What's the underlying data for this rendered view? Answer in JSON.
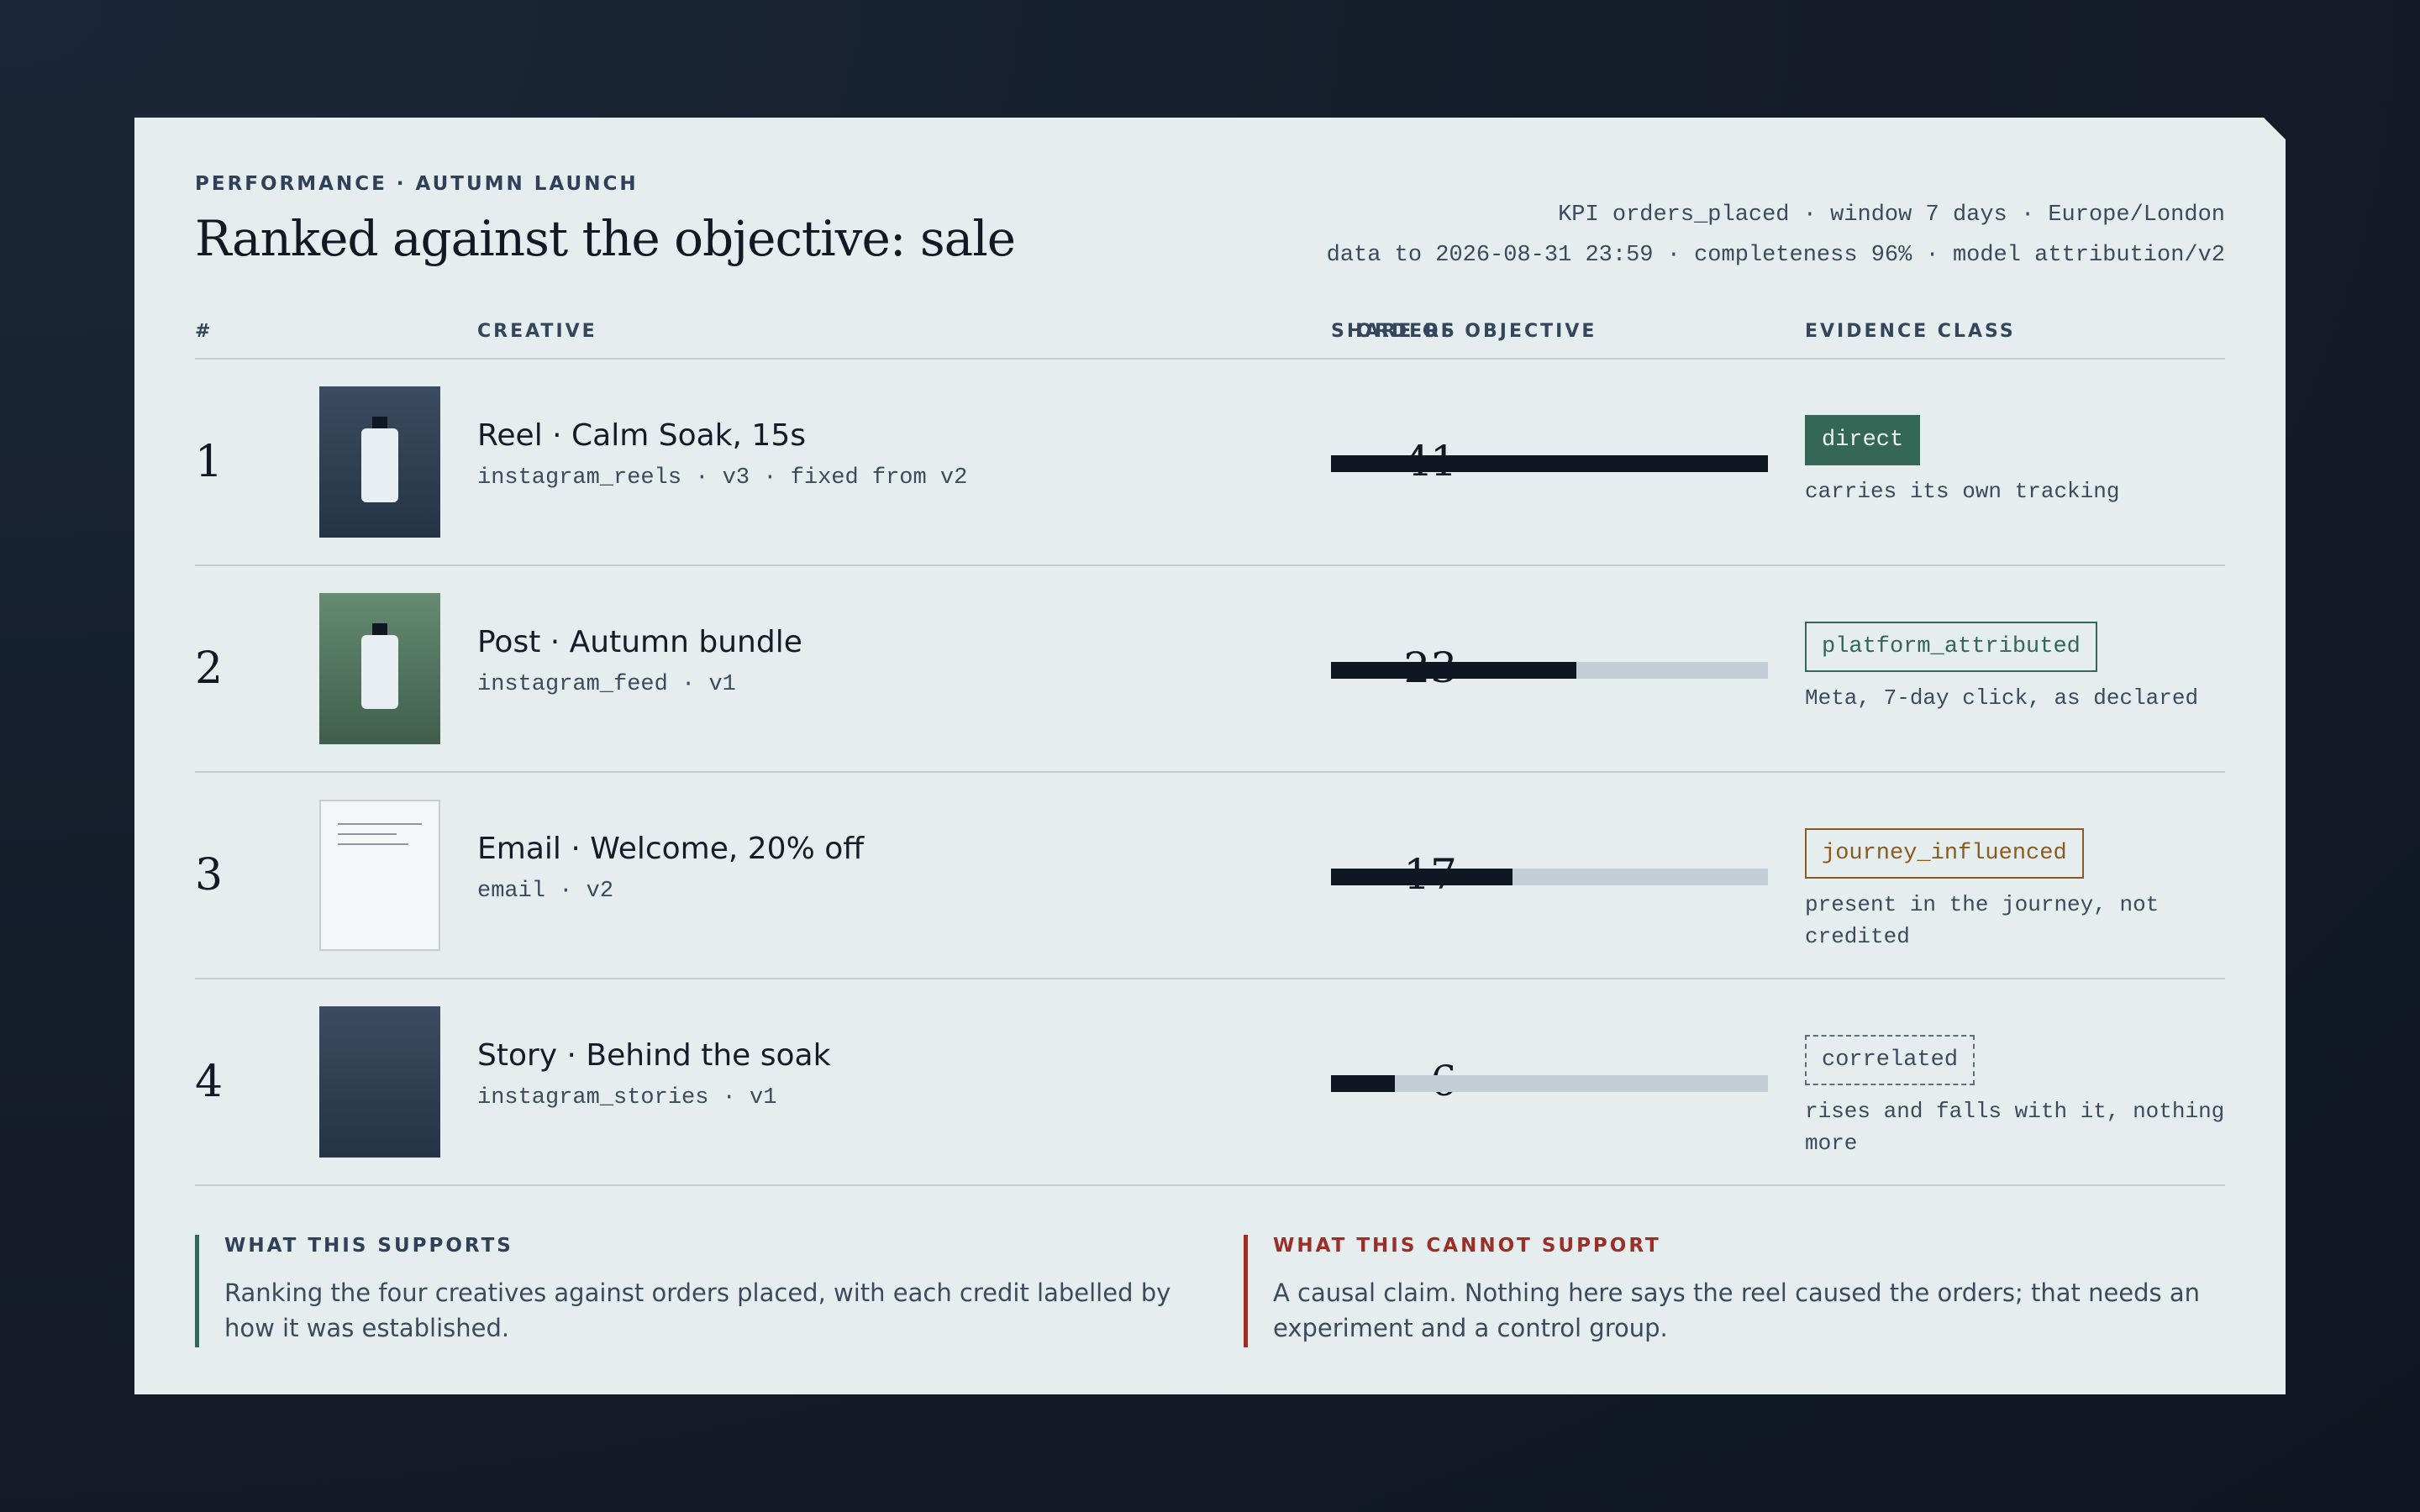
{
  "header": {
    "eyebrow": "PERFORMANCE · AUTUMN LAUNCH",
    "title": "Ranked against the objective: sale",
    "meta_line1": "KPI orders_placed · window 7 days · Europe/London",
    "meta_line2": "data to 2026-08-31 23:59 · completeness 96% · model attribution/v2"
  },
  "columns": {
    "rank": "#",
    "creative": "CREATIVE",
    "orders": "ORDERS",
    "share": "SHARE OF OBJECTIVE",
    "evidence": "EVIDENCE CLASS"
  },
  "rows": [
    {
      "rank": "1",
      "name": "Reel · Calm Soak, 15s",
      "sub": "instagram_reels · v3 · fixed from v2",
      "orders": "41",
      "share_fraction": 1.0,
      "thumb": "bottle-dark",
      "badge": "direct",
      "badge_style": "direct",
      "desc": "carries its own tracking"
    },
    {
      "rank": "2",
      "name": "Post · Autumn bundle",
      "sub": "instagram_feed · v1",
      "orders": "23",
      "share_fraction": 0.561,
      "thumb": "bottle-green",
      "badge": "platform_attributed",
      "badge_style": "platform",
      "desc": "Meta, 7-day click, as declared"
    },
    {
      "rank": "3",
      "name": "Email · Welcome, 20% off",
      "sub": "email · v2",
      "orders": "17",
      "share_fraction": 0.415,
      "thumb": "document",
      "badge": "journey_influenced",
      "badge_style": "journey",
      "desc": "present in the journey, not credited"
    },
    {
      "rank": "4",
      "name": "Story · Behind the soak",
      "sub": "instagram_stories · v1",
      "orders": "6",
      "share_fraction": 0.146,
      "thumb": "plain-dark",
      "badge": "correlated",
      "badge_style": "corr",
      "desc": "rises and falls with it, nothing more"
    }
  ],
  "notes": {
    "supports_heading": "WHAT THIS SUPPORTS",
    "supports_body": "Ranking the four creatives against orders placed, with each credit labelled by how it was established.",
    "cannot_heading": "WHAT THIS CANNOT SUPPORT",
    "cannot_body": "A causal claim. Nothing here says the reel caused the orders; that needs an experiment and a control group."
  },
  "colors": {
    "card": "#e5edef",
    "ink": "#111a24",
    "bar_fill": "#0f1822",
    "bar_track": "#c4ced7",
    "direct": "#346756",
    "journey": "#8a5b1f",
    "warning": "#9c2f25"
  }
}
